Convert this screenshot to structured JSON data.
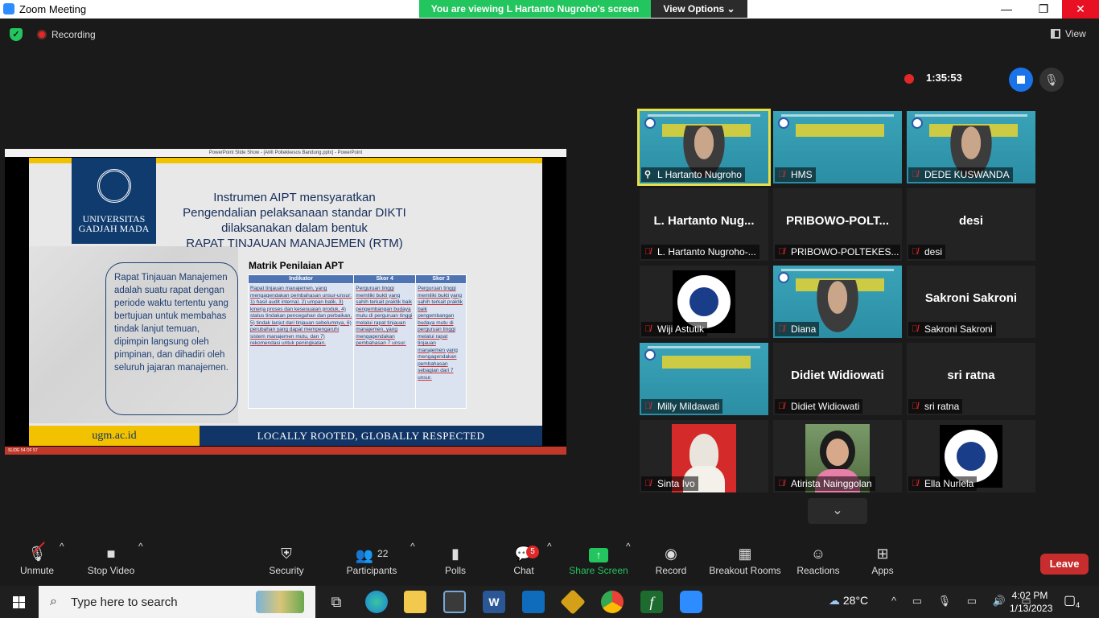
{
  "window": {
    "title": "Zoom Meeting",
    "banner_message": "You are viewing L Hartanto Nugroho's screen",
    "view_options_label": "View Options ⌄",
    "minimize": "—",
    "restore": "❐",
    "close": "✕"
  },
  "status": {
    "recording_label": "Recording",
    "view_label": "View",
    "timer": "1:35:53"
  },
  "shared_screen": {
    "ppt_window_title": "PowerPoint Slide Show - [AMI Poltekkesos Bandung.pptx] - PowerPoint",
    "slide_status": "SLIDE 54 OF 57",
    "university_name": "UNIVERSITAS GADJAH MADA",
    "headline_lines": [
      "Instrumen AIPT mensyaratkan",
      "Pengendalian pelaksanaan standar DIKTI",
      "dilaksanakan dalam bentuk",
      "RAPAT TINJAUAN MANAJEMEN (RTM)"
    ],
    "bubble_text": "Rapat Tinjauan Manajemen adalah suatu rapat dengan periode waktu tertentu yang bertujuan untuk membahas tindak lanjut temuan, dipimpin langsung oleh pimpinan, dan dihadiri oleh seluruh jajaran manajemen.",
    "matrix_title": "Matrik Penilaian APT",
    "table_headers": [
      "Indikator",
      "Skor 4",
      "Skor 3"
    ],
    "table_cells": [
      "Rapat tinjauan manajemen, yang mengagendakan pembahasan unsur-unsur: 1) hasil audit internal, 2) umpan balik, 3) kinerja proses dan kesesuaian produk, 4) status tindakan pencegahan dan perbaikan, 5) tindak lanjut dari tinjauan sebelumnya, 6) perubahan yang dapat mempengaruhi sistem manajemen mutu, dan 7) rekomendasi untuk peningkatan.",
      "Perguruan tinggi memiliki bukti yang sahih terkait praktik baik pengembangan budaya mutu di perguruan tinggi melalui rapat tinjauan manajemen, yang mengagendakan pembahasan 7 unsur.",
      "Perguruan tinggi memiliki bukti yang sahih terkait praktik baik pengembangan budaya mutu di perguruan tinggi melalui rapat tinjauan manajemen yang mengagendakan pembahasan sebagian dari 7 unsur."
    ],
    "footer_left": "ugm.ac.id",
    "footer_right": "LOCALLY ROOTED, GLOBALLY RESPECTED"
  },
  "gallery": {
    "tiles": [
      {
        "label": "L Hartanto Nugroho",
        "big": "",
        "kind": "slide-person",
        "pinned": true
      },
      {
        "label": "HMS",
        "big": "",
        "kind": "slide",
        "pinned": false
      },
      {
        "label": "DEDE KUSWANDA",
        "big": "",
        "kind": "slide-person",
        "pinned": false
      },
      {
        "label": "L. Hartanto Nugroho-...",
        "big": "L. Hartanto Nug...",
        "kind": "name",
        "pinned": false
      },
      {
        "label": "PRIBOWO-POLTEKES...",
        "big": "PRIBOWO-POLT...",
        "kind": "name",
        "pinned": false
      },
      {
        "label": "desi",
        "big": "desi",
        "kind": "name",
        "pinned": false
      },
      {
        "label": "Wiji Astutik",
        "big": "",
        "kind": "logo",
        "pinned": false
      },
      {
        "label": "Diana",
        "big": "",
        "kind": "slide-person",
        "pinned": false
      },
      {
        "label": "Sakroni Sakroni",
        "big": "Sakroni Sakroni",
        "kind": "name",
        "pinned": false
      },
      {
        "label": "Milly Mildawati",
        "big": "",
        "kind": "slide",
        "pinned": false
      },
      {
        "label": "Didiet Widiowati",
        "big": "Didiet Widiowati",
        "kind": "name",
        "pinned": false
      },
      {
        "label": "sri ratna",
        "big": "sri ratna",
        "kind": "name",
        "pinned": false
      },
      {
        "label": "Sinta Ivo",
        "big": "",
        "kind": "photo-red",
        "pinned": false
      },
      {
        "label": "Atirista Nainggolan",
        "big": "",
        "kind": "photo-green",
        "pinned": false
      },
      {
        "label": "Ella Nurlela",
        "big": "",
        "kind": "logo",
        "pinned": false
      }
    ],
    "more_label": "⌄"
  },
  "toolbar": {
    "unmute": "Unmute",
    "stop_video": "Stop Video",
    "security": "Security",
    "participants": "Participants",
    "participants_count": "22",
    "polls": "Polls",
    "chat": "Chat",
    "chat_badge": "5",
    "share_screen": "Share Screen",
    "record": "Record",
    "breakout_rooms": "Breakout Rooms",
    "reactions": "Reactions",
    "apps": "Apps",
    "leave": "Leave"
  },
  "taskbar": {
    "search_placeholder": "Type here to search",
    "weather": "28°C",
    "time": "4:02 PM",
    "date": "1/13/2023",
    "notifications_count": "4"
  },
  "colors": {
    "zoom_blue": "#2d8cff",
    "banner_green": "#23c55e",
    "leave_red": "#c72d2d",
    "ugm_navy": "#113566",
    "ugm_yellow": "#f2c100",
    "active_speaker": "#e8e04a"
  }
}
